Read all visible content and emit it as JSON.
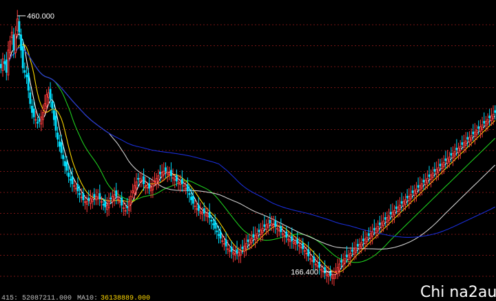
{
  "chart_data": {
    "type": "candlestick",
    "y_range": [
      160,
      470
    ],
    "grid": "horizontal dotted",
    "colors": {
      "up": "#ff3c3c",
      "down": "#00e0ff",
      "background": "#000000",
      "grid": "#7a1515",
      "ma_fast": "#ffffff",
      "ma_slow": "#ffd800",
      "ma_long1": "#1ecc1e",
      "ma_long2": "#d0d0d0",
      "ma_long3": "#1a2ed8"
    },
    "annotations": {
      "high_label": "460.000",
      "low_label": "166.400"
    },
    "status_bar": {
      "left_text": "415: 52087211.000",
      "ma_label": "MA10:",
      "ma_value": "36138889.000",
      "color_main": "#c0c0c0",
      "color_ma": "#ffd800"
    },
    "watermark": "Chi na2au",
    "closes": [
      400,
      410,
      405,
      395,
      420,
      430,
      440,
      420,
      438,
      455,
      440,
      420,
      400,
      395,
      390,
      375,
      360,
      350,
      345,
      342,
      338,
      340,
      345,
      350,
      360,
      370,
      372,
      365,
      355,
      342,
      330,
      320,
      312,
      305,
      298,
      290,
      285,
      278,
      274,
      270,
      268,
      265,
      262,
      258,
      255,
      252,
      250,
      250,
      251,
      253,
      254,
      255,
      256,
      255,
      253,
      250,
      246,
      244,
      246,
      250,
      253,
      256,
      258,
      256,
      253,
      250,
      246,
      243,
      240,
      243,
      250,
      256,
      262,
      268,
      272,
      275,
      276,
      274,
      270,
      268,
      266,
      265,
      266,
      269,
      273,
      276,
      279,
      281,
      283,
      284,
      284,
      283,
      281,
      279,
      277,
      275,
      273,
      272,
      271,
      270,
      268,
      265,
      262,
      258,
      252,
      248,
      245,
      242,
      240,
      239,
      238,
      237,
      236,
      234,
      232,
      228,
      224,
      220,
      216,
      212,
      209,
      206,
      203,
      200,
      197,
      195,
      194,
      193,
      192,
      192,
      193,
      195,
      197,
      200,
      203,
      205,
      207,
      209,
      210,
      212,
      214,
      216,
      218,
      220,
      222,
      224,
      225,
      226,
      225,
      224,
      222,
      220,
      218,
      216,
      214,
      212,
      210,
      208,
      207,
      206,
      205,
      204,
      203,
      201,
      199,
      197,
      195,
      192,
      189,
      186,
      184,
      182,
      180,
      178,
      176,
      174,
      172,
      170,
      169,
      168,
      167,
      166.4,
      168,
      172,
      176,
      180,
      182,
      184,
      186,
      188,
      190,
      192,
      194,
      196,
      198,
      200,
      202,
      204,
      206,
      208,
      210,
      212,
      214,
      216,
      218,
      220,
      222,
      224,
      226,
      228,
      230,
      232,
      234,
      236,
      238,
      240,
      242,
      244,
      246,
      248,
      250,
      252,
      254,
      256,
      258,
      260,
      262,
      264,
      266,
      268,
      270,
      272,
      274,
      276,
      278,
      280,
      282,
      284,
      286,
      288,
      290,
      292,
      294,
      296,
      298,
      300,
      302,
      304,
      306,
      308,
      310,
      312,
      314,
      316,
      318,
      320,
      322,
      324,
      326,
      328,
      330,
      332,
      334,
      336,
      338,
      340,
      342,
      344,
      346,
      348,
      350
    ]
  }
}
